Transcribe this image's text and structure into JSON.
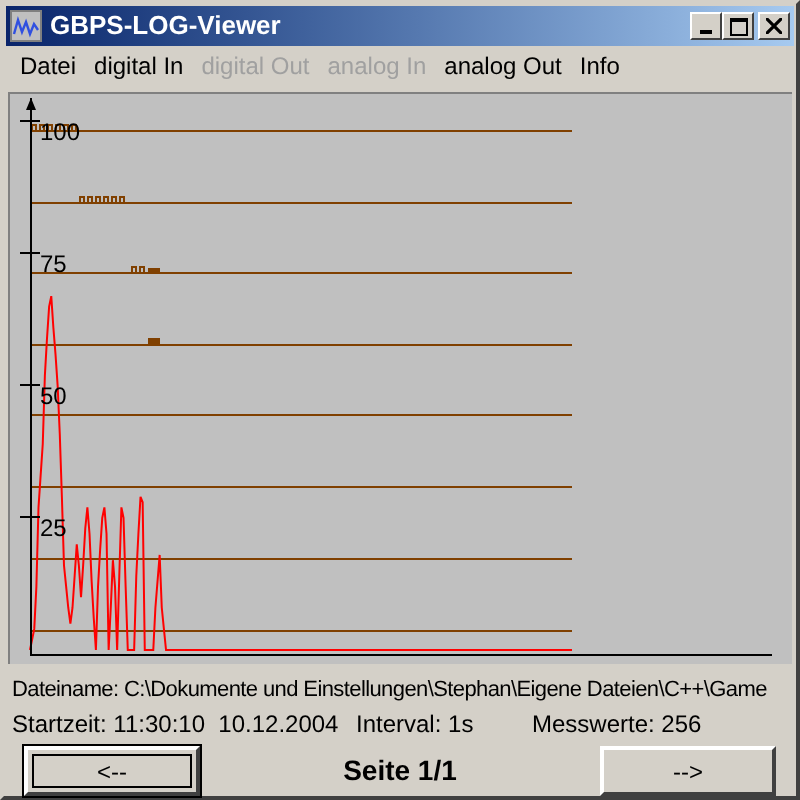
{
  "window": {
    "title": "GBPS-LOG-Viewer"
  },
  "menu": [
    {
      "label": "Datei",
      "disabled": false
    },
    {
      "label": "digital In",
      "disabled": false
    },
    {
      "label": "digital Out",
      "disabled": true
    },
    {
      "label": "analog In",
      "disabled": true
    },
    {
      "label": "analog Out",
      "disabled": false
    },
    {
      "label": "Info",
      "disabled": false
    }
  ],
  "chart": {
    "chart_data": {
      "type": "line",
      "yticks": [
        25,
        50,
        75,
        100
      ],
      "ylim": [
        0,
        104.5
      ],
      "series": [
        {
          "color": "#ff0000",
          "values": [
            0,
            2,
            4,
            12,
            27,
            33,
            39,
            52,
            59,
            65,
            67,
            61,
            56,
            50,
            41,
            29,
            16,
            12,
            8,
            5,
            8,
            14,
            20,
            16,
            10,
            16,
            23,
            27,
            22,
            13,
            6,
            0,
            12,
            19,
            25,
            27,
            22,
            0,
            8,
            17,
            12,
            0,
            14,
            27,
            25,
            12,
            0,
            0,
            0,
            0,
            14,
            22,
            29,
            28,
            0,
            0,
            0,
            0,
            0,
            8,
            13,
            18,
            8,
            4,
            0,
            0,
            0,
            0,
            0,
            0,
            0,
            0,
            0,
            0,
            0,
            0,
            0,
            0,
            0,
            0,
            0,
            0,
            0,
            0,
            0,
            0,
            0,
            0,
            0,
            0,
            0,
            0,
            0,
            0,
            0,
            0,
            0,
            0,
            0,
            0,
            0,
            0,
            0,
            0,
            0,
            0,
            0,
            0,
            0,
            0,
            0,
            0,
            0,
            0,
            0,
            0,
            0,
            0,
            0,
            0,
            0,
            0,
            0,
            0,
            0,
            0,
            0,
            0,
            0,
            0,
            0,
            0,
            0,
            0,
            0,
            0,
            0,
            0,
            0,
            0,
            0,
            0,
            0,
            0,
            0,
            0,
            0,
            0,
            0,
            0,
            0,
            0,
            0,
            0,
            0,
            0,
            0,
            0,
            0,
            0,
            0,
            0,
            0,
            0,
            0,
            0,
            0,
            0,
            0,
            0,
            0,
            0,
            0,
            0,
            0,
            0,
            0,
            0,
            0,
            0,
            0,
            0,
            0,
            0,
            0,
            0,
            0,
            0,
            0,
            0,
            0,
            0,
            0,
            0,
            0,
            0,
            0,
            0,
            0,
            0,
            0,
            0,
            0,
            0,
            0,
            0,
            0,
            0,
            0,
            0,
            0,
            0,
            0,
            0,
            0,
            0,
            0,
            0,
            0,
            0,
            0,
            0,
            0,
            0,
            0,
            0,
            0,
            0,
            0,
            0,
            0,
            0,
            0,
            0,
            0,
            0,
            0,
            0,
            0,
            0,
            0,
            0,
            0,
            0,
            0,
            0,
            0,
            0,
            0,
            0,
            0,
            0,
            0,
            0,
            0,
            0
          ]
        }
      ]
    }
  },
  "status": {
    "filename": "Dateiname: C:\\Dokumente und Einstellungen\\Stephan\\Eigene Dateien\\C++\\Game",
    "start_time": "Startzeit: 11:30:10  10.12.2004",
    "interval": "Interval: 1s",
    "sample_count": "Messwerte: 256"
  },
  "nav": {
    "prev": {
      "label": "<--",
      "focused": true
    },
    "page": "Seite 1/1",
    "next": {
      "label": "-->",
      "focused": false
    }
  }
}
